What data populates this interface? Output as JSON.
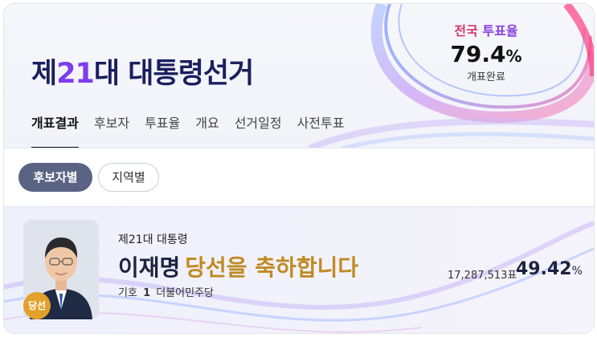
{
  "header": {
    "title_prefix": "제",
    "title_number": "21",
    "title_suffix": "대 대통령선거",
    "turnout_label_a": "전국",
    "turnout_label_b": "투표율",
    "turnout_value": "79.4",
    "turnout_unit": "%",
    "turnout_status": "개표완료"
  },
  "tabs": [
    {
      "label": "개표결과",
      "active": true
    },
    {
      "label": "후보자",
      "active": false
    },
    {
      "label": "투표율",
      "active": false
    },
    {
      "label": "개요",
      "active": false
    },
    {
      "label": "선거일정",
      "active": false
    },
    {
      "label": "사전투표",
      "active": false
    }
  ],
  "filters": {
    "by_candidate": "후보자별",
    "by_region": "지역별"
  },
  "winner": {
    "badge": "당선",
    "office": "제21대 대통령",
    "name": "이재명",
    "congrats": "당선을 축하합니다",
    "number_label": "기호",
    "number": "1",
    "party": "더불어민주당",
    "votes": "17,287,513표",
    "rate": "49.42",
    "rate_unit": "%"
  },
  "colors": {
    "title": "#1b1f5e",
    "title_number": "#7d3cf0",
    "pill_active": "#5b6384",
    "congrats": "#c08a22",
    "badge": "#e2a12a"
  }
}
